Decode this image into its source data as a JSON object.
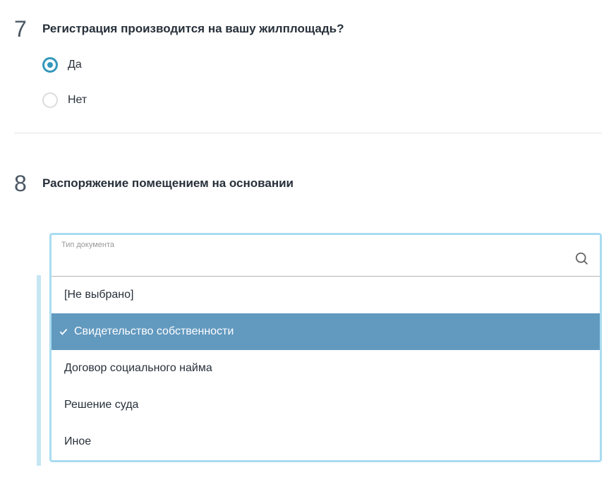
{
  "q7": {
    "number": "7",
    "title": "Регистрация производится на вашу жилплощадь?",
    "options": {
      "yes": "Да",
      "no": "Нет"
    },
    "selected": "yes"
  },
  "q8": {
    "number": "8",
    "title": "Распоряжение помещением на основании",
    "select": {
      "label": "Тип документа",
      "options": {
        "none": "[Не выбрано]",
        "certificate": "Свидетельство собственности",
        "contract": "Договор социального найма",
        "court": "Решение суда",
        "other": "Иное"
      },
      "selected": "certificate"
    }
  }
}
